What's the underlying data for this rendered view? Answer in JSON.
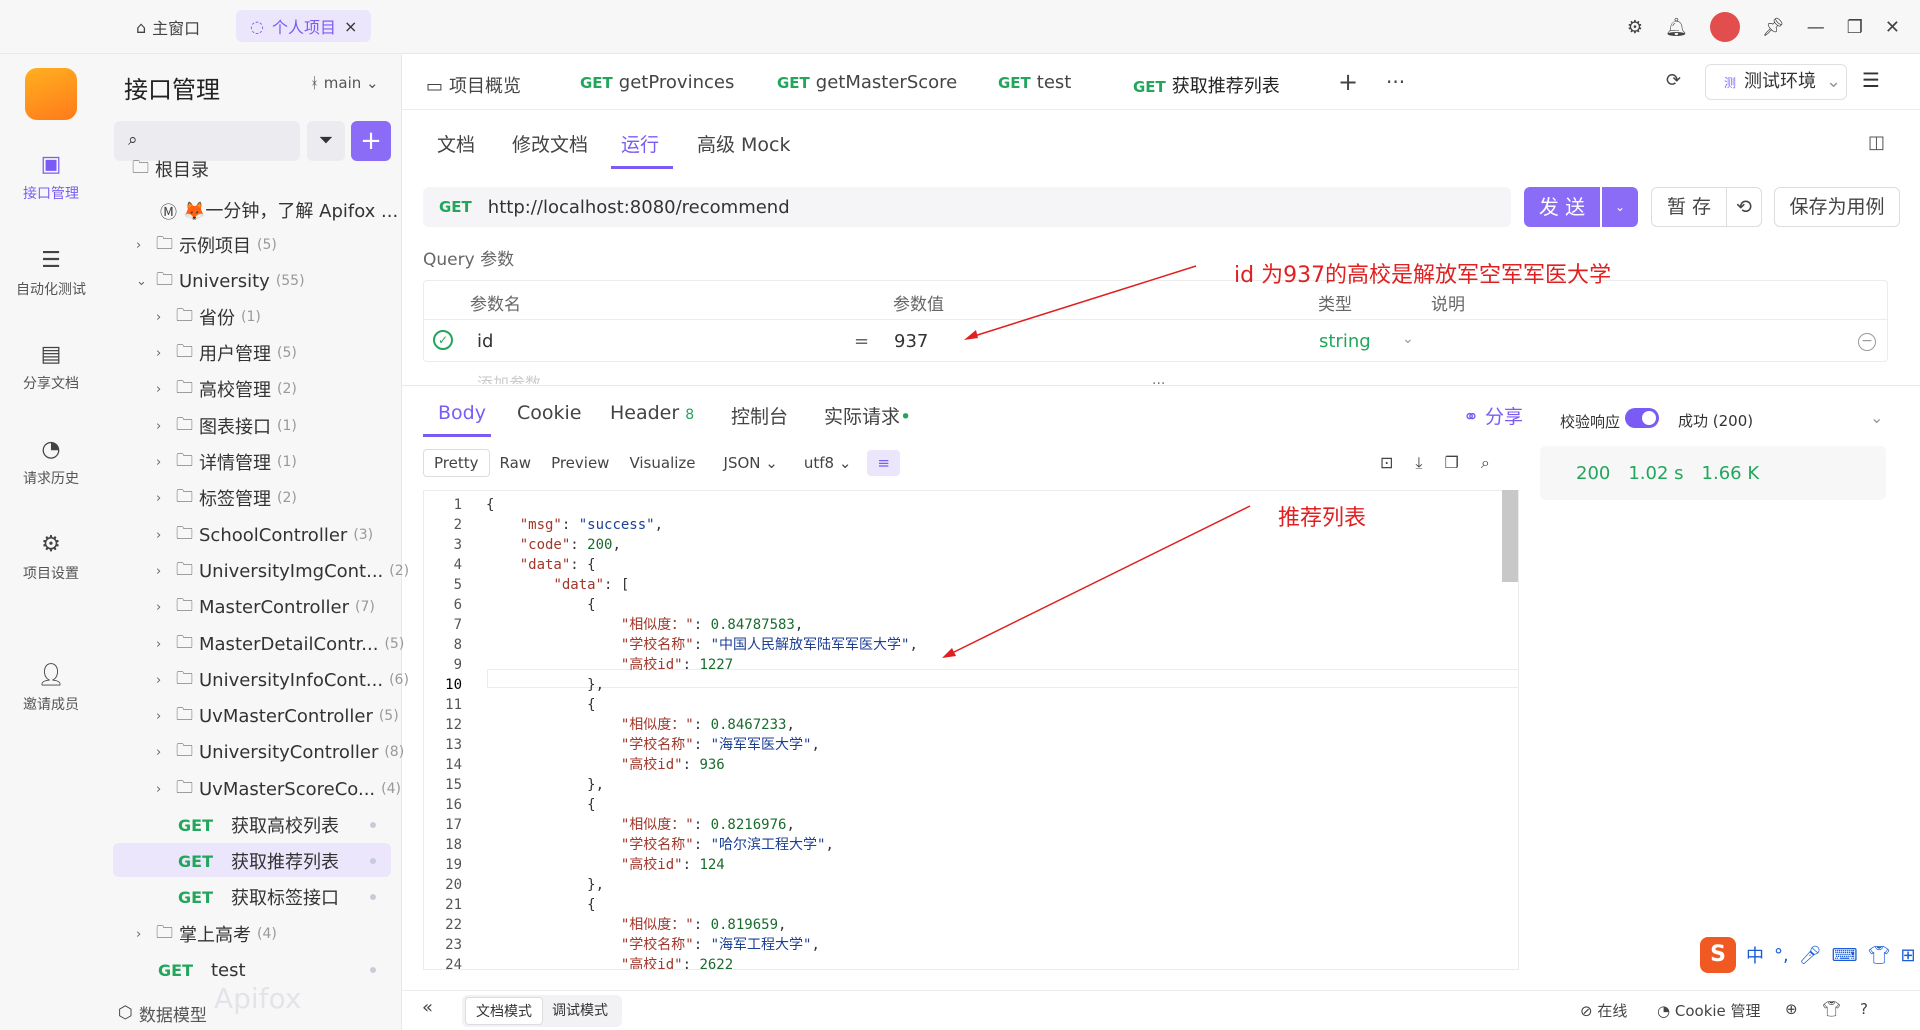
{
  "titlebar": {
    "home": "主窗口",
    "tab": "个人项目"
  },
  "rail": [
    {
      "label": "接口管理",
      "icon": "api-icon"
    },
    {
      "label": "自动化测试",
      "icon": "automation-icon"
    },
    {
      "label": "分享文档",
      "icon": "share-doc-icon"
    },
    {
      "label": "请求历史",
      "icon": "history-icon"
    },
    {
      "label": "项目设置",
      "icon": "settings-icon"
    },
    {
      "label": "邀请成员",
      "icon": "invite-icon"
    }
  ],
  "sidebar": {
    "title": "接口管理",
    "branch": "main",
    "tree": [
      {
        "label": "根目录",
        "count": "",
        "type": "folder"
      },
      {
        "label": "🦊一分钟，了解 Apifox ...",
        "count": "",
        "type": "doc"
      },
      {
        "label": "示例项目",
        "count": "(5)",
        "type": "folder"
      },
      {
        "label": "University",
        "count": "(55)",
        "type": "folder"
      },
      {
        "label": "省份",
        "count": "(1)",
        "type": "folder"
      },
      {
        "label": "用户管理",
        "count": "(5)",
        "type": "folder"
      },
      {
        "label": "高校管理",
        "count": "(2)",
        "type": "folder"
      },
      {
        "label": "图表接口",
        "count": "(1)",
        "type": "folder"
      },
      {
        "label": "详情管理",
        "count": "(1)",
        "type": "folder"
      },
      {
        "label": "标签管理",
        "count": "(2)",
        "type": "folder"
      },
      {
        "label": "SchoolController",
        "count": "(3)",
        "type": "folder"
      },
      {
        "label": "UniversityImgCont...",
        "count": "(2)",
        "type": "folder"
      },
      {
        "label": "MasterController",
        "count": "(7)",
        "type": "folder"
      },
      {
        "label": "MasterDetailContr...",
        "count": "(5)",
        "type": "folder"
      },
      {
        "label": "UniversityInfoCont...",
        "count": "(6)",
        "type": "folder"
      },
      {
        "label": "UvMasterController",
        "count": "(5)",
        "type": "folder"
      },
      {
        "label": "UniversityController",
        "count": "(8)",
        "type": "folder"
      },
      {
        "label": "UvMasterScoreCo...",
        "count": "(4)",
        "type": "folder"
      },
      {
        "label": "获取高校列表",
        "method": "GET",
        "type": "api"
      },
      {
        "label": "获取推荐列表",
        "method": "GET",
        "type": "api"
      },
      {
        "label": "获取标签接口",
        "method": "GET",
        "type": "api"
      },
      {
        "label": "掌上高考",
        "count": "(4)",
        "type": "folder"
      },
      {
        "label": "test",
        "method": "GET",
        "type": "api"
      }
    ],
    "footer": "数据模型",
    "watermark": "Apifox"
  },
  "tabs": [
    {
      "label": "项目概览",
      "method": ""
    },
    {
      "label": "getProvinces",
      "method": "GET"
    },
    {
      "label": "getMasterScore",
      "method": "GET"
    },
    {
      "label": "test",
      "method": "GET"
    },
    {
      "label": "获取推荐列表",
      "method": "GET"
    }
  ],
  "env": "测试环境",
  "subtabs": [
    "文档",
    "修改文档",
    "运行",
    "高级 Mock"
  ],
  "request": {
    "method": "GET",
    "url": "http://localhost:8080/recommend",
    "send": "发 送",
    "save": "暂 存",
    "save_case": "保存为用例"
  },
  "query": {
    "label": "Query 参数",
    "headers": [
      "参数名",
      "参数值",
      "类型",
      "说明"
    ],
    "row": {
      "name": "id",
      "eq": "=",
      "value": "937",
      "type": "string"
    },
    "add": "添加参数"
  },
  "annotations": {
    "a1": "id 为937的高校是解放军空军军医大学",
    "a2": "推荐列表"
  },
  "response": {
    "tabs": [
      "Body",
      "Cookie",
      "Header",
      "控制台",
      "实际请求"
    ],
    "header_count": "8",
    "share": "分享",
    "formats": [
      "Pretty",
      "Raw",
      "Preview",
      "Visualize"
    ],
    "lang": "JSON",
    "enc": "utf8",
    "validate": "校验响应",
    "result": "成功 (200)",
    "status": "200",
    "time": "1.02 s",
    "size": "1.66 K",
    "lines": [
      "{",
      "    \"msg\": \"success\",",
      "    \"code\": 200,",
      "    \"data\": {",
      "        \"data\": [",
      "            {",
      "                \"相似度：\": 0.84787583,",
      "                \"学校名称\": \"中国人民解放军陆军军医大学\",",
      "                \"高校id\": 1227",
      "            },",
      "            {",
      "                \"相似度：\": 0.8467233,",
      "                \"学校名称\": \"海军军医大学\",",
      "                \"高校id\": 936",
      "            },",
      "            {",
      "                \"相似度：\": 0.8216976,",
      "                \"学校名称\": \"哈尔滨工程大学\",",
      "                \"高校id\": 124",
      "            },",
      "            {",
      "                \"相似度：\": 0.819659,",
      "                \"学校名称\": \"海军工程大学\",",
      "                \"高校id\": 2622"
    ]
  },
  "bottom": {
    "doc_mode": "文档模式",
    "debug_mode": "调试模式",
    "online": "在线",
    "cookie": "Cookie 管理"
  },
  "ime": {
    "logo": "S",
    "lang": "中"
  }
}
